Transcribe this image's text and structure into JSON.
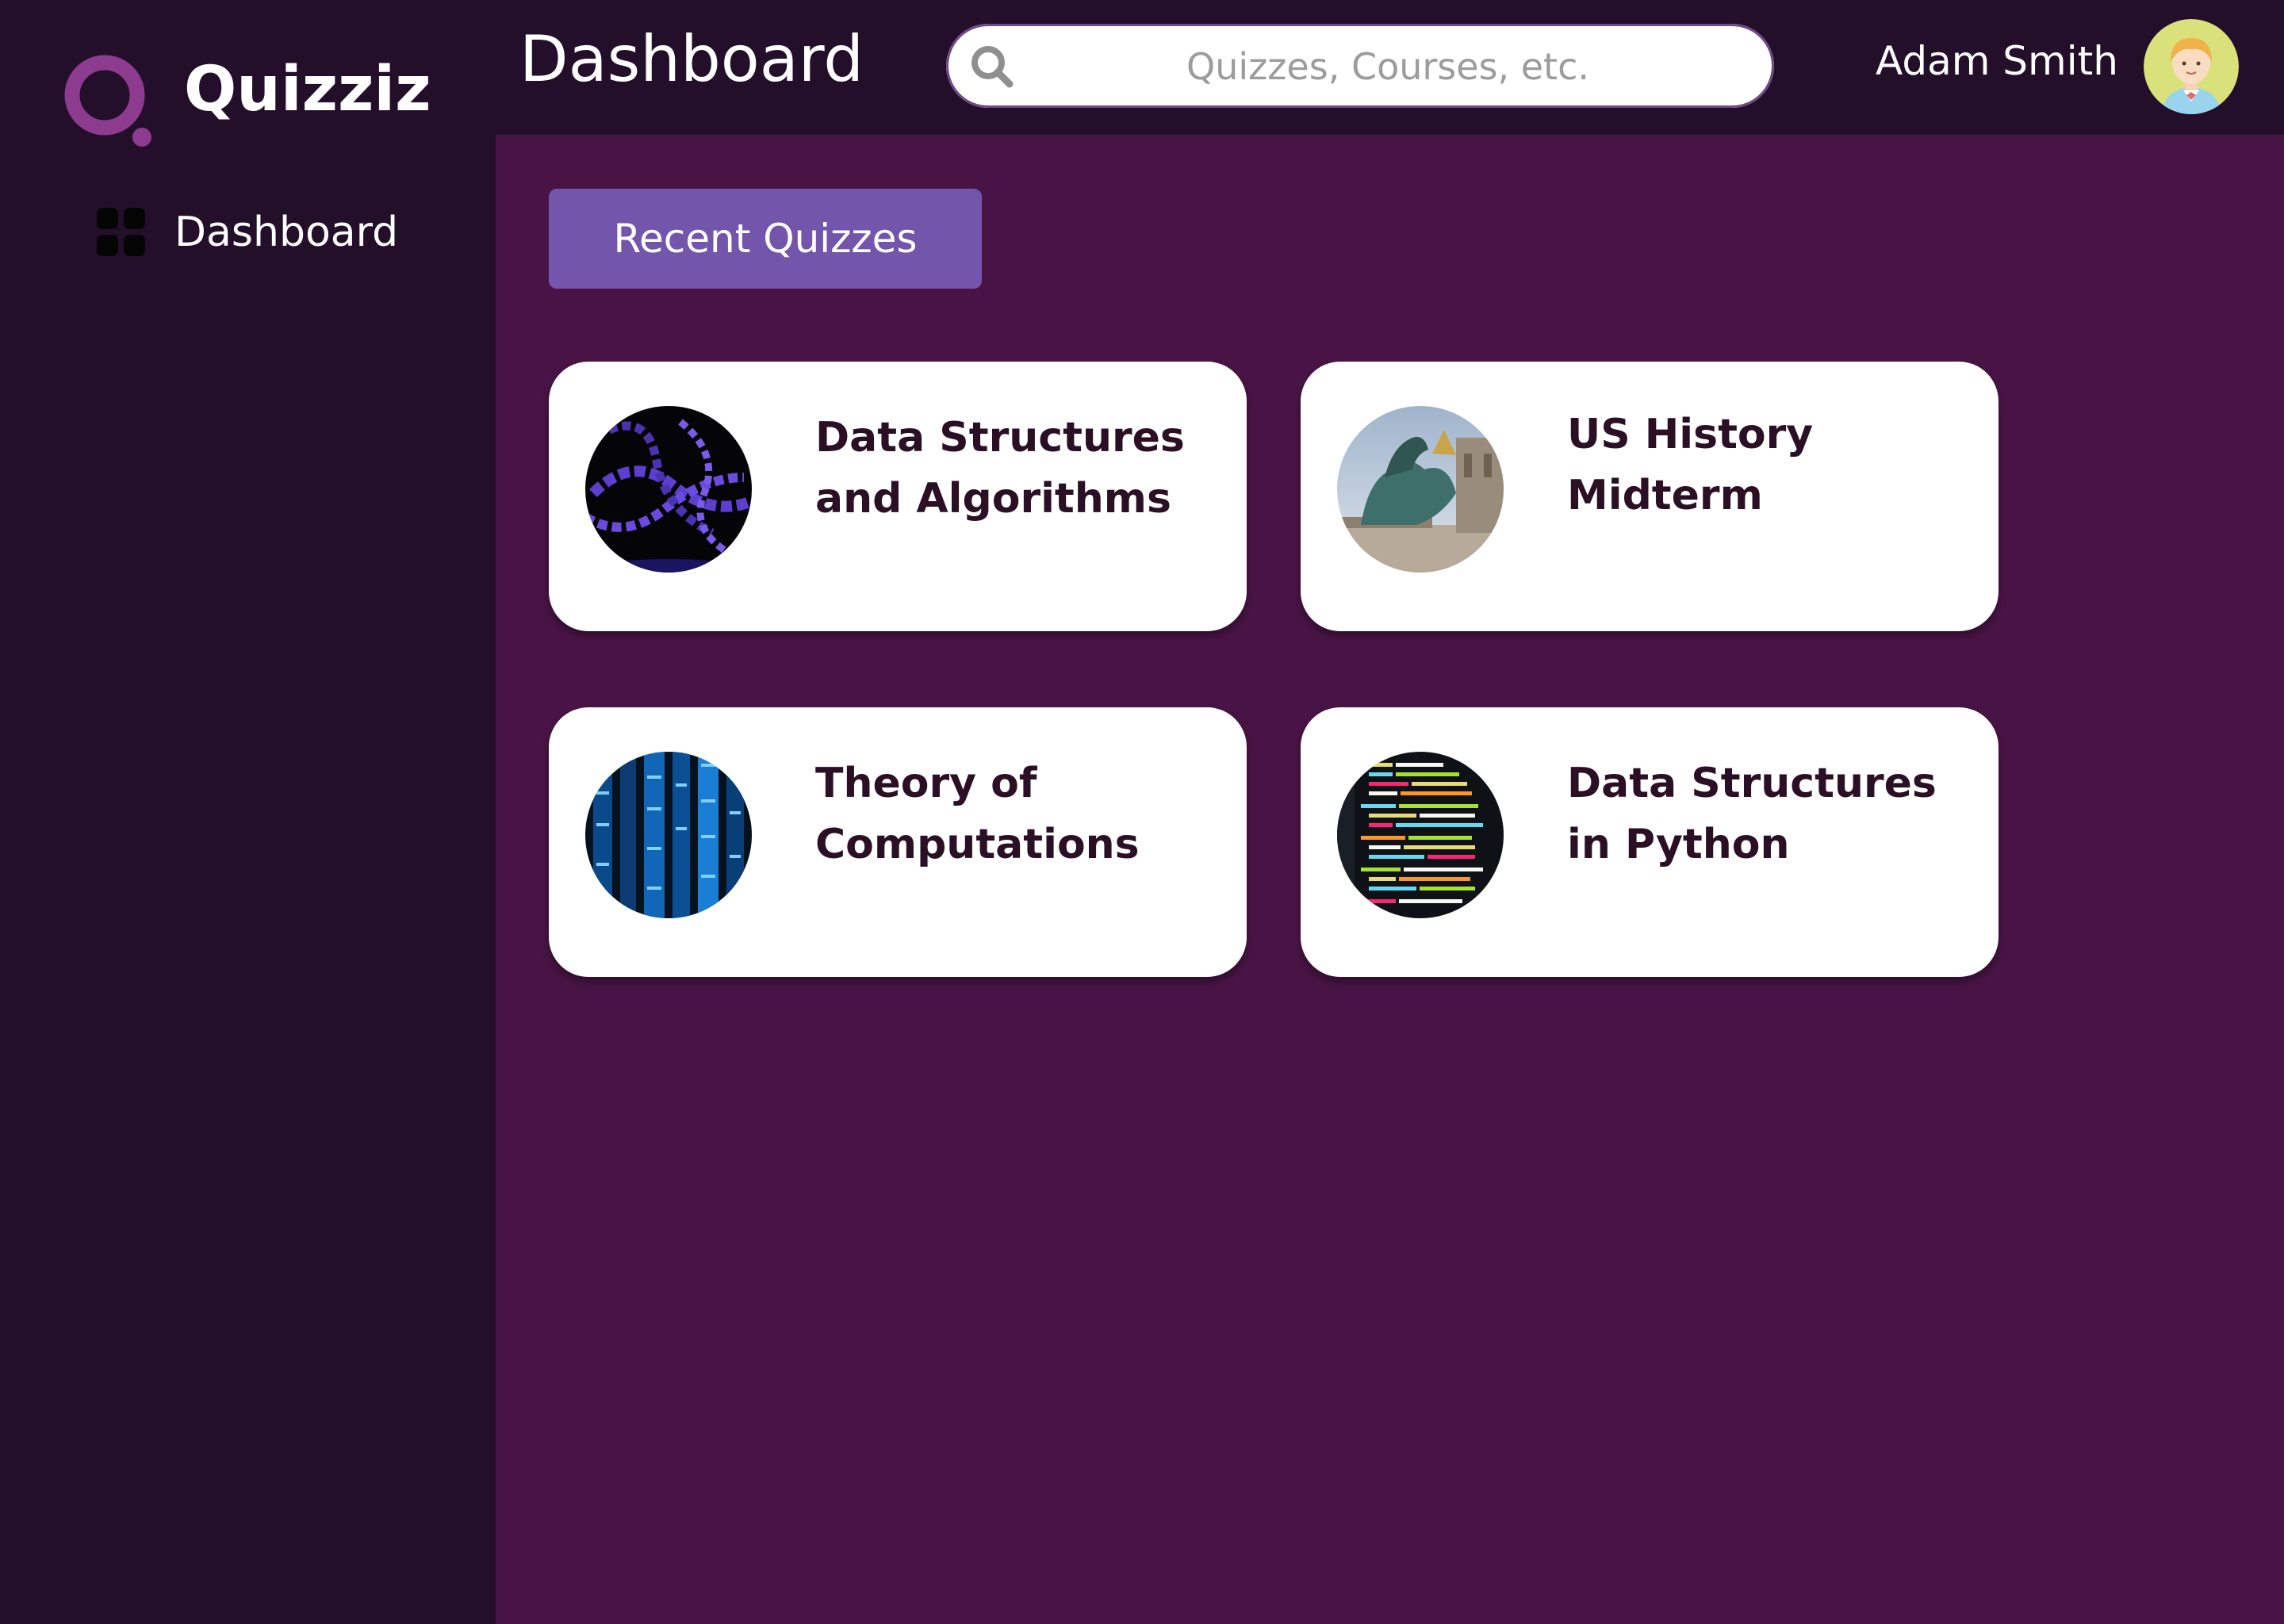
{
  "app": {
    "brand": "Quizziz",
    "brand_color": "#8c3b8e"
  },
  "sidebar": {
    "items": [
      {
        "label": "Dashboard",
        "icon": "grid-icon"
      }
    ]
  },
  "header": {
    "title": "Dashboard",
    "search": {
      "placeholder": "Quizzes, Courses, etc.",
      "value": "",
      "icon": "search-icon"
    },
    "user": {
      "name": "Adam Smith",
      "avatar": "avatar-icon"
    }
  },
  "main": {
    "tab_label": "Recent Quizzes",
    "quizzes": [
      {
        "title": "Data Structures and Algorithms",
        "thumbnail": "purple-chain-image"
      },
      {
        "title": "US History Midterm",
        "thumbnail": "statue-image"
      },
      {
        "title": "Theory of Computations",
        "thumbnail": "server-lights-image"
      },
      {
        "title": "Data Structures in Python",
        "thumbnail": "code-screen-image"
      }
    ]
  },
  "colors": {
    "sidebar_bg": "#240f2a",
    "main_bg": "#481445",
    "button_bg": "#7455ac",
    "card_text": "#2a0f25"
  }
}
